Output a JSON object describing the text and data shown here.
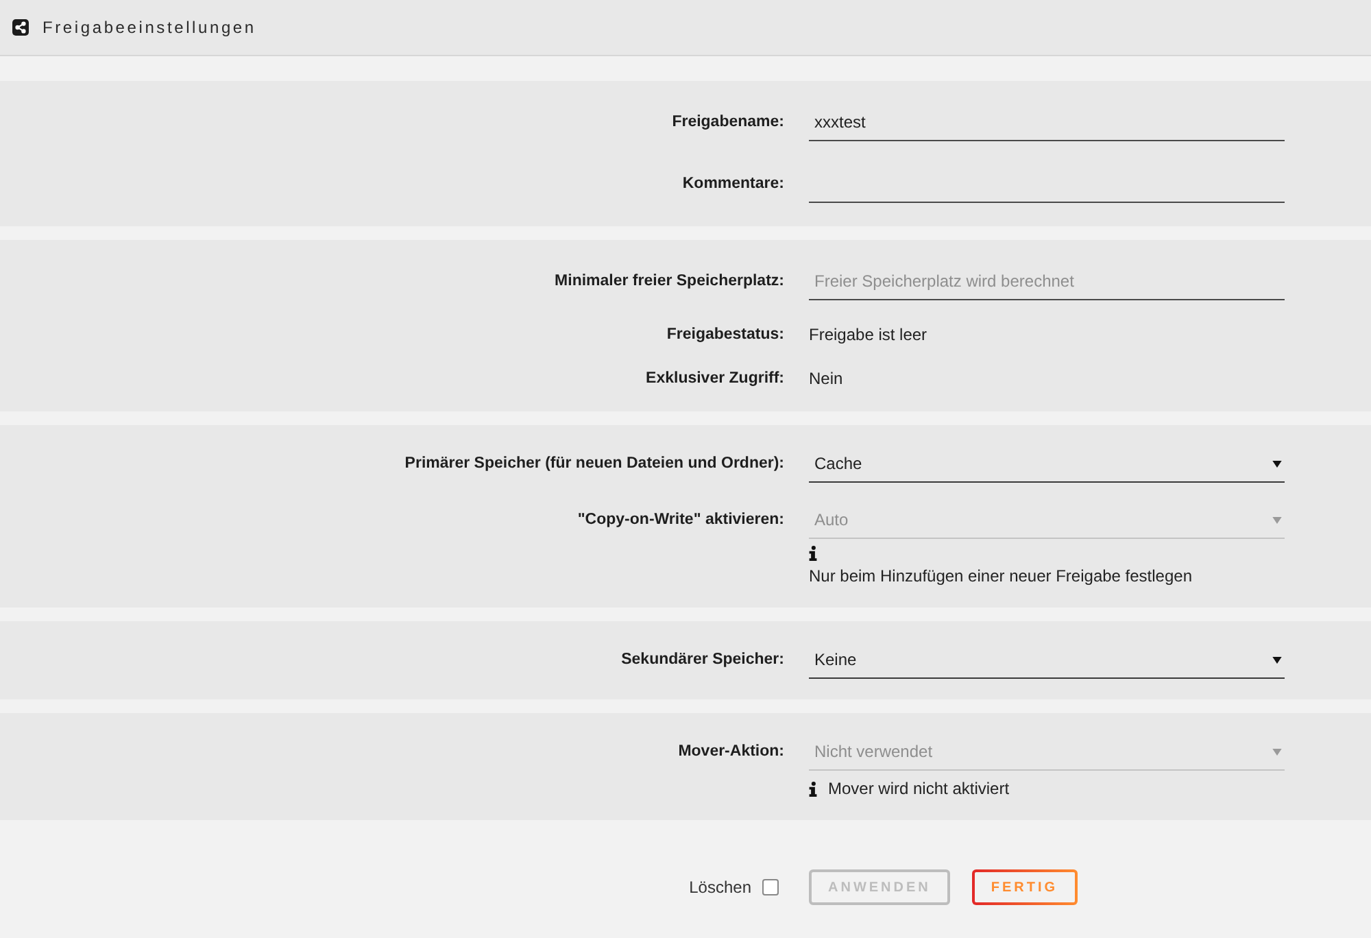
{
  "header": {
    "title": "Freigabeeinstellungen"
  },
  "sections": [
    {
      "rows": [
        {
          "kind": "input",
          "label": "Freigabename:",
          "value": "xxxtest"
        },
        {
          "kind": "input",
          "label": "Kommentare:"
        }
      ]
    },
    {
      "rows": [
        {
          "kind": "input",
          "label": "Minimaler freier Speicherplatz:",
          "placeholder": "Freier Speicherplatz wird berechnet"
        },
        {
          "kind": "text",
          "label": "Freigabestatus:",
          "value": "Freigabe ist leer"
        },
        {
          "kind": "text",
          "label": "Exklusiver Zugriff:",
          "value": "Nein"
        }
      ]
    },
    {
      "rows": [
        {
          "kind": "select",
          "label": "Primärer Speicher (für neuen Dateien und Ordner):",
          "value": "Cache",
          "disabled": false
        },
        {
          "kind": "select",
          "label": "\"Copy-on-Write\" aktivieren:",
          "value": "Auto",
          "disabled": true,
          "note": {
            "kind": "block",
            "text": "Nur beim Hinzufügen einer neuer Freigabe festlegen"
          }
        }
      ]
    },
    {
      "rows": [
        {
          "kind": "select",
          "label": "Sekundärer Speicher:",
          "value": "Keine",
          "disabled": false
        }
      ]
    },
    {
      "rows": [
        {
          "kind": "select",
          "label": "Mover-Aktion:",
          "value": "Nicht verwendet",
          "disabled": true,
          "note": {
            "kind": "inline",
            "text": "Mover wird nicht aktiviert"
          }
        }
      ]
    }
  ],
  "footer": {
    "delete": {
      "label": "Löschen",
      "checked": false
    },
    "buttons": [
      {
        "label": "ANWENDEN",
        "disabled": true
      },
      {
        "label": "FERTIG",
        "disabled": false
      }
    ]
  }
}
